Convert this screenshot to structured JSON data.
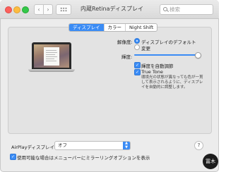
{
  "window": {
    "title": "内蔵Retinaディスプレイ",
    "search_placeholder": "検索",
    "back_glyph": "‹",
    "forward_glyph": "›"
  },
  "tabs": [
    {
      "label": "ディスプレイ",
      "active": true
    },
    {
      "label": "カラー",
      "active": false
    },
    {
      "label": "Night Shift",
      "active": false
    }
  ],
  "resolution": {
    "label": "解像度:",
    "options": [
      {
        "label": "ディスプレイのデフォルト",
        "selected": true
      },
      {
        "label": "変更",
        "selected": false
      }
    ]
  },
  "brightness": {
    "label": "輝度:",
    "level_percent": 100
  },
  "auto_brightness": {
    "label": "輝度を自動調節",
    "checked": true
  },
  "true_tone": {
    "label": "True Tone",
    "checked": true,
    "description": "環境光の状態が異なっても色が一貫して表示されるように、ディスプレイを自動的に調整します。"
  },
  "airplay": {
    "label": "AirPlayディスプレイ:",
    "value": "オフ"
  },
  "mirroring_option": {
    "label": "使用可能な場合はメニューバーにミラーリングオプションを表示",
    "checked": true
  },
  "help_glyph": "?",
  "watermark_text": "冨木",
  "colors": {
    "accent": "#3b8cf5",
    "panel": "#e3e3e3",
    "window": "#ececec"
  },
  "icons": [
    "search-icon",
    "grid-icon",
    "help-icon",
    "checkmark-icon"
  ]
}
